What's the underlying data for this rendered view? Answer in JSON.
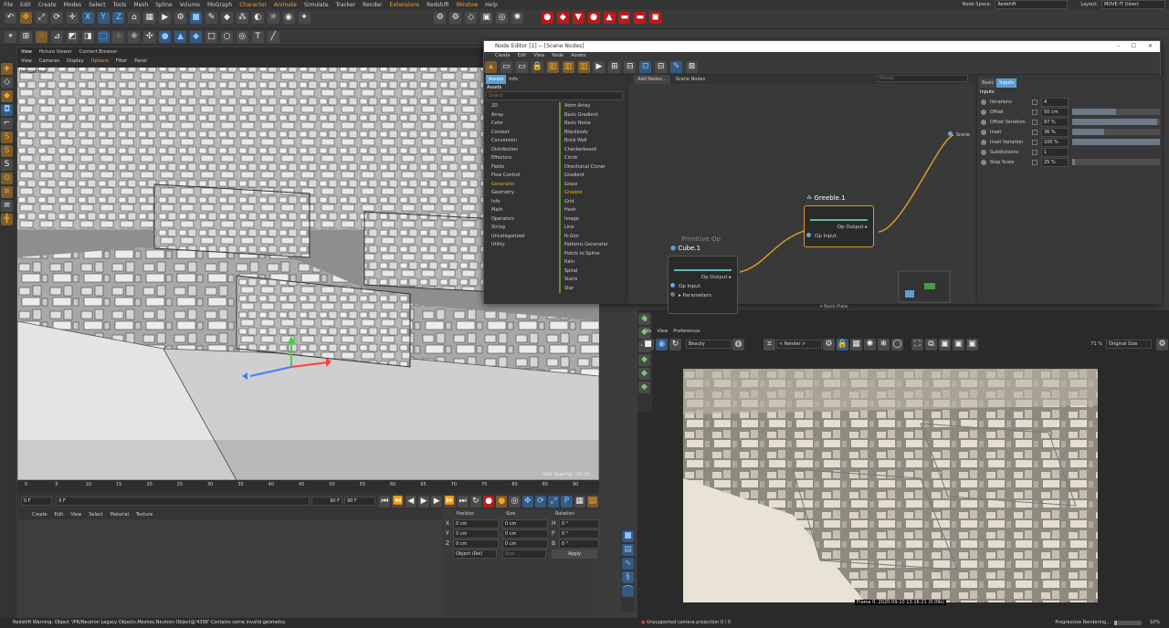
{
  "menubar": {
    "items": [
      "File",
      "Edit",
      "Create",
      "Modes",
      "Select",
      "Tools",
      "Mesh",
      "Spline",
      "Volume",
      "MoGraph",
      "Character",
      "Animate",
      "Simulate",
      "Tracker",
      "Render",
      "Extensions",
      "Redshift",
      "Window",
      "Help"
    ],
    "node_space_label": "Node Space:",
    "node_space_value": "Redshift",
    "layout_label": "Layout:",
    "layout_value": "MOVE IT (User)"
  },
  "viewport": {
    "tabs": [
      "View",
      "Picture Viewer",
      "Content Browser"
    ],
    "menu": [
      "View",
      "Cameras",
      "Display",
      "Options",
      "Filter",
      "Panel"
    ],
    "label": "Perspective",
    "grid_spacing": "Grid Spacing : 50 cm"
  },
  "timeline": {
    "ticks": [
      "0",
      "5",
      "10",
      "15",
      "20",
      "25",
      "30",
      "35",
      "40",
      "45",
      "50",
      "55",
      "60",
      "65",
      "70",
      "75",
      "80",
      "85",
      "90"
    ],
    "current": "0 F",
    "start": "0 F",
    "end": "90 F",
    "max": "90 F"
  },
  "object_manager": {
    "menu": [
      "Create",
      "Edit",
      "View",
      "Select",
      "Material",
      "Texture"
    ]
  },
  "coordinates": {
    "headers": [
      "Position",
      "Size",
      "Rotation"
    ],
    "rows": [
      {
        "a": "X",
        "p": "0 cm",
        "s": "0 cm",
        "r_axis": "H",
        "r": "0 °"
      },
      {
        "a": "Y",
        "p": "0 cm",
        "s": "0 cm",
        "r_axis": "P",
        "r": "0 °"
      },
      {
        "a": "Z",
        "p": "0 cm",
        "s": "0 cm",
        "r_axis": "B",
        "r": "0 °"
      }
    ],
    "mode": "Object (Rel)",
    "size_mode": "Size",
    "apply": "Apply"
  },
  "status": "Redshift Warning: Object '/PR/Neutron Legacy Objects.Meshes.Neutron Object@'4398' Contains some invalid geometry.",
  "node_editor": {
    "title": "Node Editor [1] -- [Scene Nodes]",
    "menu": [
      "Create",
      "Edit",
      "View",
      "Node",
      "Assets"
    ],
    "asset_tabs": [
      "Assets",
      "Info"
    ],
    "assets_header": "Assets",
    "search_placeholder": "Search",
    "categories": [
      "2D",
      "Array",
      "Color",
      "Context",
      "Conversion",
      "Distribution",
      "Effectors",
      "Fields",
      "Flow Control",
      "Generator",
      "Geometry",
      "Info",
      "Math",
      "Operators",
      "String",
      "Uncategorized",
      "Utility"
    ],
    "selected_category": "Generator",
    "items": [
      "Atom Array",
      "Basic Gradient",
      "Basic Noise",
      "Blackbody",
      "Brick Wall",
      "Checkerboard",
      "Circle",
      "Directional Cloner",
      "Gradient",
      "Grass",
      "Greeble",
      "Grid",
      "Hash",
      "Image",
      "Line",
      "N-Gon",
      "Patterns Generator",
      "Points to Spline",
      "Rain",
      "Spiral",
      "Stairs",
      "Star"
    ],
    "selected_item": "Greeble",
    "graph_tabs": [
      "Add Nodes...",
      "Scene Nodes"
    ],
    "reveal_placeholder": "Reveal",
    "scene_label": "Scene",
    "cube_node": {
      "category": "Primitive Op",
      "title": "Cube.1",
      "output": "Op Output",
      "input": "Op Input",
      "params": "Parameters"
    },
    "greeble_node": {
      "title": "Greeble.1",
      "output": "Op Output",
      "input": "Op Input"
    },
    "attr_tabs": [
      "Basic",
      "Inputs"
    ],
    "attr_header": "Inputs",
    "attrs": [
      {
        "name": "Iterations",
        "value": "4",
        "fill": null
      },
      {
        "name": "Offset",
        "value": "50 cm",
        "fill": 0.5
      },
      {
        "name": "Offset Variation",
        "value": "97 %",
        "fill": 0.97
      },
      {
        "name": "Inset",
        "value": "36 %",
        "fill": 0.36
      },
      {
        "name": "Inset Variation",
        "value": "100 %",
        "fill": 1.0
      },
      {
        "name": "Subdivisions",
        "value": "1",
        "fill": null
      },
      {
        "name": "Step Scale",
        "value": "25 %",
        "fill": 0.03
      }
    ]
  },
  "render_view": {
    "backplate": "Back-Plate",
    "menu": [
      "File",
      "View",
      "Preferences"
    ],
    "aov": "Beauty",
    "render_btn": "< Render >",
    "zoom": "71 %",
    "size": "Original Size",
    "frame_info": "Frame 0: 2020-09-10  13:16:21  (0.09s)",
    "status": "Unsupported camera projection 0 / 0",
    "progress": "Progressive Rendering...",
    "progress_pct": "10%"
  },
  "colors": {
    "accent": "#f5a623",
    "node_wire": "#d89a2a",
    "greeble_border": "#d89a2a",
    "selection": "#5a9fd4"
  }
}
